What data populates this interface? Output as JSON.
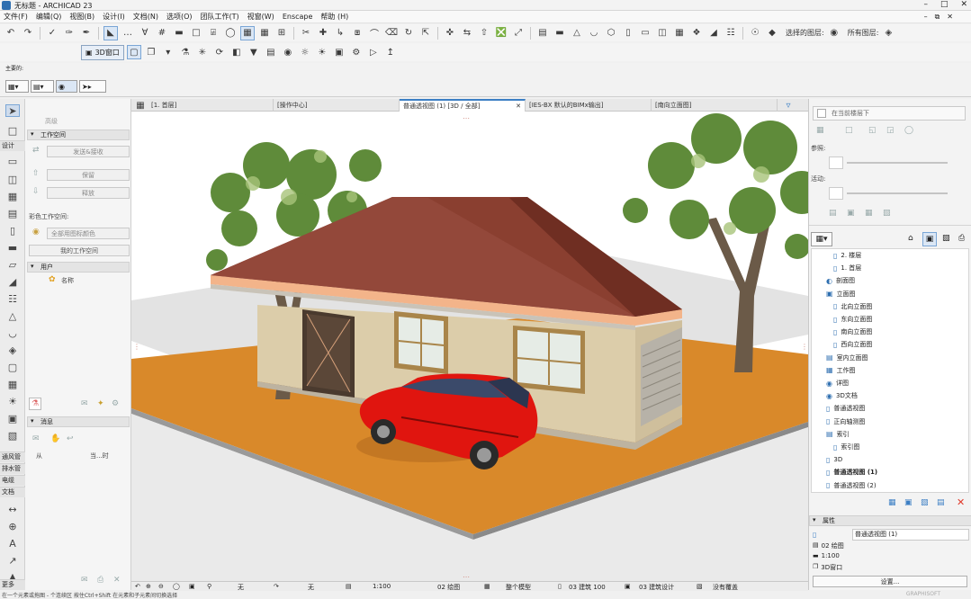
{
  "app": {
    "title": "无标题 - ARCHICAD 23"
  },
  "menu": [
    "文件(F)",
    "编辑(Q)",
    "视图(B)",
    "设计(I)",
    "文档(N)",
    "选项(O)",
    "团队工作(T)",
    "视窗(W)",
    "Enscape",
    "帮助 (H)"
  ],
  "toolbar": {
    "view3d_label": "3D窗口",
    "selected_layers_label": "选择的图层:",
    "all_layers_label": "所有图层:"
  },
  "infobox": {
    "main_label": "主要的:"
  },
  "toolbox": {
    "categories": {
      "design": "设计",
      "ventilation": "通风管",
      "drainage": "排水管",
      "electrical": "电缆",
      "document": "文档",
      "more": "更多"
    }
  },
  "left_palette": {
    "item_hidden": "高级",
    "workspace_header": "工作空间",
    "send_receive": "发送&接收",
    "reserve": "保留",
    "release": "释放",
    "color_workspace_label": "彩色工作空间:",
    "color_dropdown": "全部用图标颜色",
    "my_workspace": "我的工作空间",
    "users_header": "用户",
    "name_label": "名称",
    "messages_header": "消息",
    "col_from": "从",
    "col_when": "当...时"
  },
  "tabs": [
    {
      "label": "[1. 首层]"
    },
    {
      "label": "[操作中心]"
    },
    {
      "label": "普通透视图 (1) [3D / 全部]"
    },
    {
      "label": "[IES-BX 默认的BIMx输出]"
    },
    {
      "label": "[南向立面图]"
    }
  ],
  "status_bar": {
    "none_1": "无",
    "none_2": "无",
    "scale": "1:100",
    "drawing_layer": "02 绘图",
    "model": "整个模型",
    "structure": "03 建筑 100",
    "arch_design": "03 建筑设计",
    "no_cover": "没有覆盖"
  },
  "right_panel": {
    "layer_filter": "在当前楼层下",
    "reference_label": "参照:",
    "active_label": "活动:",
    "nav_items": [
      {
        "label": "2. 楼层",
        "level": 2
      },
      {
        "label": "1. 首层",
        "level": 2
      },
      {
        "label": "剖面图",
        "level": 1
      },
      {
        "label": "立面图",
        "level": 1
      },
      {
        "label": "北向立面图",
        "level": 2
      },
      {
        "label": "东向立面图",
        "level": 2
      },
      {
        "label": "南向立面图",
        "level": 2
      },
      {
        "label": "西向立面图",
        "level": 2
      },
      {
        "label": "室内立面图",
        "level": 1
      },
      {
        "label": "工作图",
        "level": 1
      },
      {
        "label": "详图",
        "level": 1
      },
      {
        "label": "3D文档",
        "level": 1
      },
      {
        "label": "普通透视图",
        "level": 1
      },
      {
        "label": "正向轴测图",
        "level": 1
      },
      {
        "label": "索引",
        "level": 1
      },
      {
        "label": "索引图",
        "level": 2
      },
      {
        "label": "3D",
        "level": 1
      },
      {
        "label": "普通透视图 (1)",
        "level": 1,
        "bold": true
      },
      {
        "label": "普通透视图 (2)",
        "level": 1
      }
    ],
    "properties_header": "属性",
    "prop_name": "普通透视图 (1)",
    "prop_layer": "02 绘图",
    "prop_scale": "1:100",
    "prop_window": "3D窗口",
    "settings_button": "设置..."
  },
  "bottom_hint": "在一个元素或拖图 - 个连续区 按住Ctrl+Shift 在元素和子元素间切换选择",
  "watermark": "GRAPHISOFT"
}
